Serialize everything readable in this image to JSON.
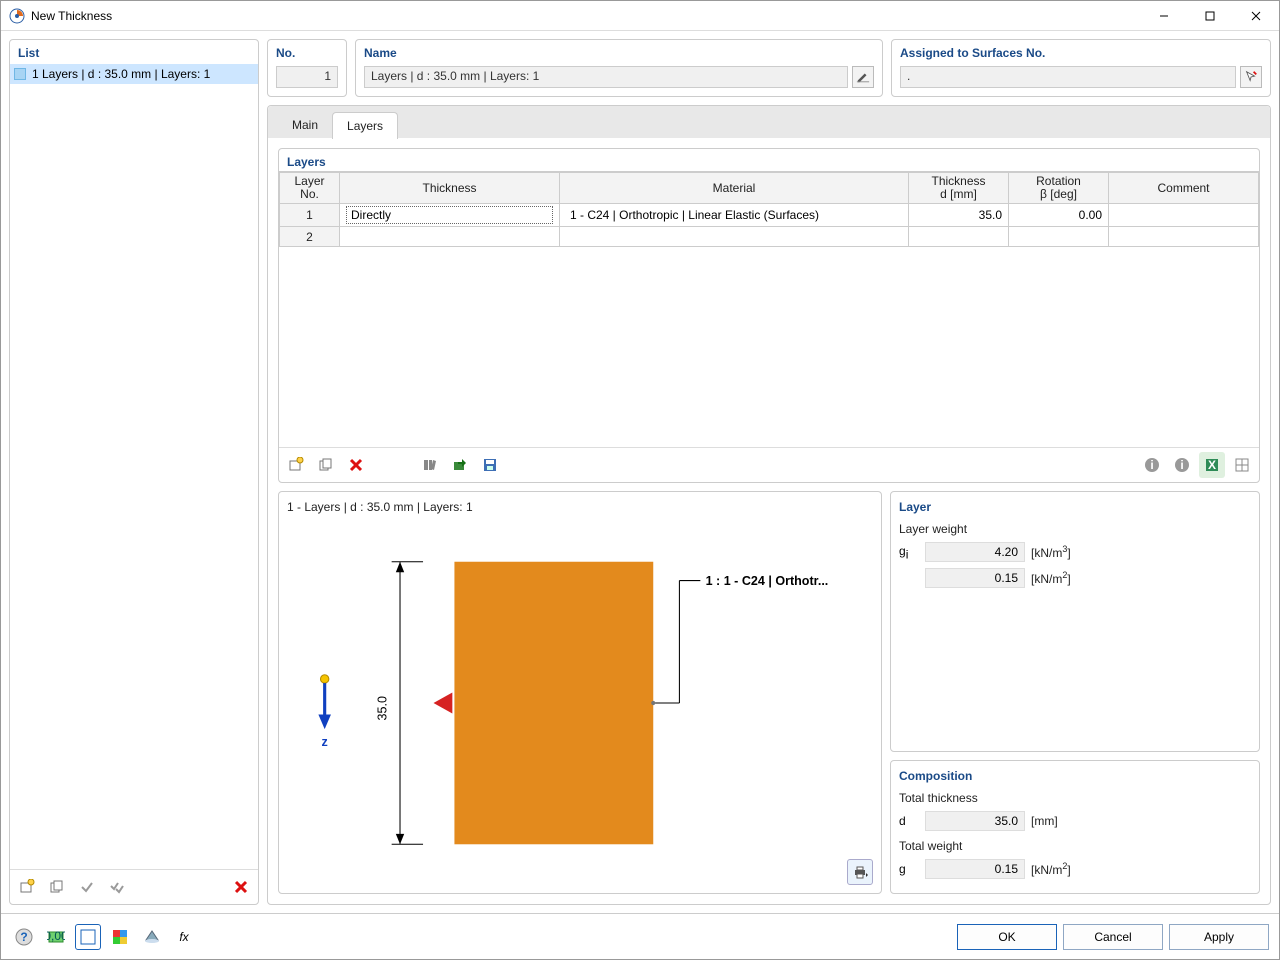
{
  "window": {
    "title": "New Thickness"
  },
  "list": {
    "title": "List",
    "item": "1   Layers | d : 35.0 mm | Layers: 1"
  },
  "fields": {
    "no_label": "No.",
    "no_value": "1",
    "name_label": "Name",
    "name_value": "Layers | d : 35.0 mm | Layers: 1",
    "assigned_label": "Assigned to Surfaces No.",
    "assigned_value": "."
  },
  "tabs": {
    "main": "Main",
    "layers": "Layers"
  },
  "layers": {
    "title": "Layers",
    "cols": {
      "layer_no": "Layer\nNo.",
      "thickness": "Thickness",
      "material": "Material",
      "thickness_d": "Thickness\nd [mm]",
      "rotation": "Rotation\nβ [deg]",
      "comment": "Comment"
    },
    "rows": [
      {
        "no": "1",
        "thickness": "Directly",
        "material": "1 - C24 | Orthotropic | Linear Elastic (Surfaces)",
        "d": "35.0",
        "beta": "0.00",
        "comment": ""
      },
      {
        "no": "2",
        "thickness": "",
        "material": "",
        "d": "",
        "beta": "",
        "comment": ""
      }
    ]
  },
  "preview": {
    "title": "1 - Layers | d : 35.0 mm | Layers: 1",
    "z": "z",
    "dim": "35.0",
    "legend": "1 : 1 - C24 | Orthotr..."
  },
  "layer_panel": {
    "title": "Layer",
    "weight_label": "Layer weight",
    "gi": "gi",
    "gi_val": "4.20",
    "gi_unit": "[kN/m³]",
    "g2_val": "0.15",
    "g2_unit": "[kN/m²]"
  },
  "composition": {
    "title": "Composition",
    "total_thickness_lbl": "Total thickness",
    "d_sym": "d",
    "d_val": "35.0",
    "d_unit": "[mm]",
    "total_weight_lbl": "Total weight",
    "g_sym": "g",
    "g_val": "0.15",
    "g_unit": "[kN/m²]"
  },
  "buttons": {
    "ok": "OK",
    "cancel": "Cancel",
    "apply": "Apply"
  }
}
